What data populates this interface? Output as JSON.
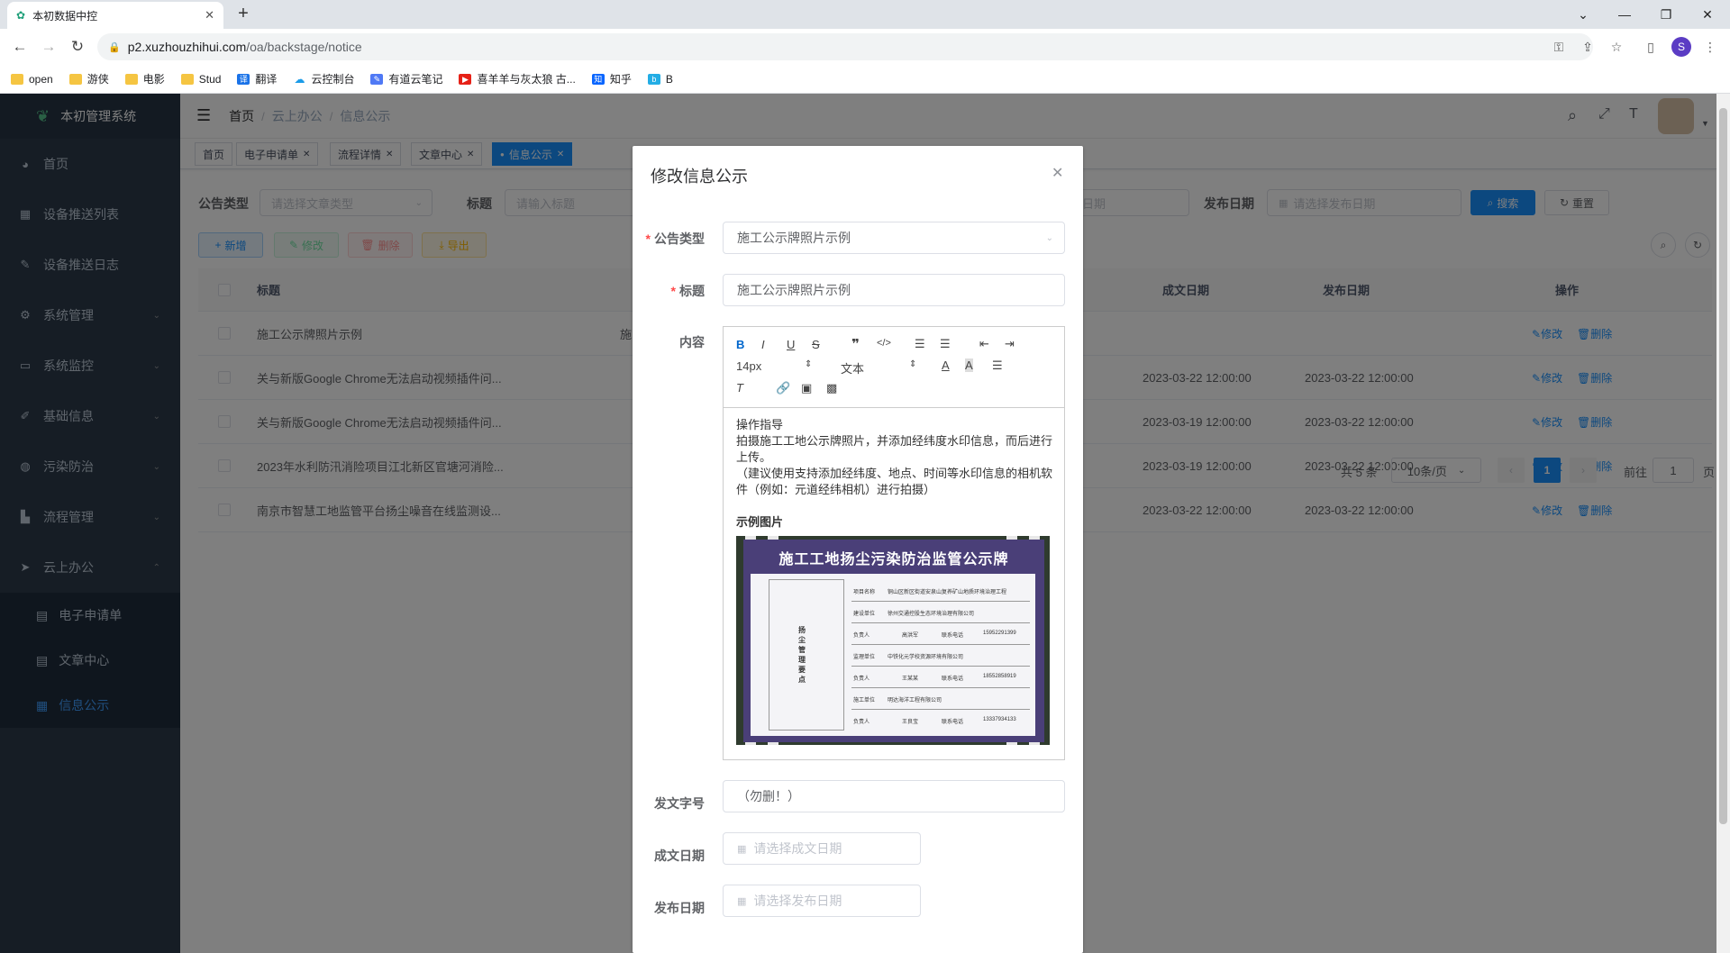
{
  "browser": {
    "tab_title": "本初数据中控",
    "url_host": "p2.xuzhouzhihui.com",
    "url_path": "/oa/backstage/notice",
    "profile_initial": "S",
    "bookmarks": [
      {
        "label": "open",
        "icon": "folder-icon"
      },
      {
        "label": "游侠",
        "icon": "folder-icon"
      },
      {
        "label": "电影",
        "icon": "folder-icon"
      },
      {
        "label": "Stud",
        "icon": "folder-icon"
      },
      {
        "label": "翻译",
        "icon": "translate-icon"
      },
      {
        "label": "云控制台",
        "icon": "cloud-icon"
      },
      {
        "label": "有道云笔记",
        "icon": "note-icon"
      },
      {
        "label": "喜羊羊与灰太狼 古...",
        "icon": "youtube-icon"
      },
      {
        "label": "知乎",
        "icon": "zhihu-icon"
      },
      {
        "label": "B",
        "icon": "bilibili-icon"
      }
    ]
  },
  "sidebar": {
    "app_title": "本初管理系统",
    "items": [
      {
        "label": "首页",
        "icon": "dashboard-icon"
      },
      {
        "label": "设备推送列表",
        "icon": "table-icon"
      },
      {
        "label": "设备推送日志",
        "icon": "log-icon"
      },
      {
        "label": "系统管理",
        "icon": "system-icon"
      },
      {
        "label": "系统监控",
        "icon": "monitor-icon"
      },
      {
        "label": "基础信息",
        "icon": "edit-icon"
      },
      {
        "label": "污染防治",
        "icon": "globe-icon"
      },
      {
        "label": "流程管理",
        "icon": "chart-icon"
      },
      {
        "label": "云上办公",
        "icon": "send-icon"
      }
    ],
    "sub_items": [
      {
        "label": "电子申请单",
        "icon": "form-icon"
      },
      {
        "label": "文章中心",
        "icon": "document-icon"
      },
      {
        "label": "信息公示",
        "icon": "grid-icon"
      }
    ]
  },
  "header": {
    "breadcrumb": [
      "首页",
      "云上办公",
      "信息公示"
    ]
  },
  "tags": [
    "首页",
    "电子申请单",
    "流程详情",
    "文章中心",
    "信息公示"
  ],
  "search": {
    "type_label": "公告类型",
    "type_placeholder": "请选择文章类型",
    "title_label": "标题",
    "title_placeholder": "请输入标题",
    "date_placeholder_partial": "日期",
    "publish_label": "发布日期",
    "publish_placeholder": "请选择发布日期",
    "search_btn": "搜索",
    "reset_btn": "重置"
  },
  "actions": {
    "add": "新增",
    "edit": "修改",
    "delete": "删除",
    "export": "导出"
  },
  "table": {
    "headers": {
      "title": "标题",
      "written_date": "成文日期",
      "publish_date": "发布日期",
      "ops": "操作"
    },
    "rows": [
      {
        "title": "施工公示牌照片示例",
        "type": "施",
        "written": "",
        "published": ""
      },
      {
        "title": "关与新版Google Chrome无法启动视频插件问...",
        "type": "",
        "written": "2023-03-22 12:00:00",
        "published": "2023-03-22 12:00:00"
      },
      {
        "title": "关与新版Google Chrome无法启动视频插件问...",
        "type": "",
        "written": "2023-03-19 12:00:00",
        "published": "2023-03-22 12:00:00"
      },
      {
        "title": "2023年水利防汛消险项目江北新区官塘河消险...",
        "type": "",
        "written": "2023-03-19 12:00:00",
        "published": "2023-03-22 12:00:00"
      },
      {
        "title": "南京市智慧工地监管平台扬尘噪音在线监测设...",
        "type": "",
        "written": "2023-03-22 12:00:00",
        "published": "2023-03-22 12:00:00"
      }
    ],
    "op_edit": "修改",
    "op_delete": "删除"
  },
  "pager": {
    "total": "共 5 条",
    "page_size": "10条/页",
    "current": "1",
    "goto_label": "前往",
    "goto_value": "1",
    "page_suffix": "页"
  },
  "dialog": {
    "title": "修改信息公示",
    "type_label": "公告类型",
    "type_value": "施工公示牌照片示例",
    "title_label": "标题",
    "title_value": "施工公示牌照片示例",
    "content_label": "内容",
    "toolbar": {
      "size": "14px",
      "style": "文本"
    },
    "content": {
      "heading": "操作指导",
      "para1": "拍摄施工工地公示牌照片，并添加经纬度水印信息，而后进行上传。",
      "para2": "（建议使用支持添加经纬度、地点、时间等水印信息的相机软件（例如：元道经纬相机）进行拍摄）",
      "sample_label": "示例图片"
    },
    "sample_sign": {
      "title": "施工工地扬尘污染防治监管公示牌",
      "side_label": "扬尘管理要点",
      "rows": [
        [
          "项目名称",
          "铜山区新区街道安泉山复养矿山地质环境治理工程"
        ],
        [
          "建设单位",
          "徐州交通控股生态环境治理有限公司"
        ],
        [
          "负责人",
          "高洪军",
          "联系电话",
          "15952291399"
        ],
        [
          "监理单位",
          "中铁化元学校资源环境有限公司"
        ],
        [
          "负责人",
          "王某某",
          "联系电话",
          "18552858919"
        ],
        [
          "施工单位",
          "明达海洋工程有限公司"
        ],
        [
          "负责人",
          "王良宝",
          "联系电话",
          "13337934133"
        ]
      ]
    },
    "doc_no_label": "发文字号",
    "doc_no_value": "（勿删！）",
    "written_label": "成文日期",
    "written_placeholder": "请选择成文日期",
    "publish_label": "发布日期",
    "publish_placeholder": "请选择发布日期"
  }
}
